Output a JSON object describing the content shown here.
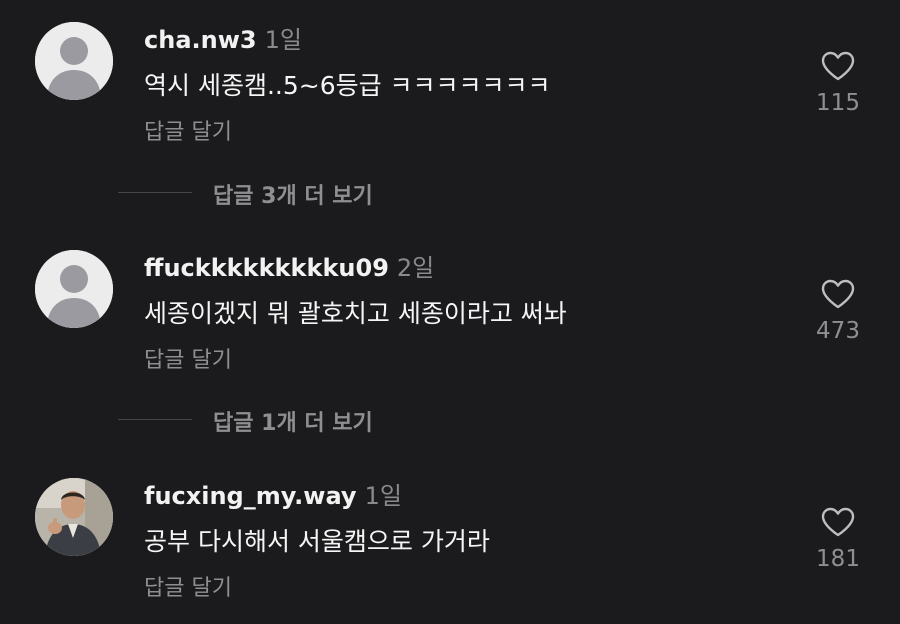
{
  "comments": [
    {
      "username": "cha.nw3",
      "time": "1일",
      "text": "역시 세종캠..5~6등급 ㅋㅋㅋㅋㅋㅋㅋ",
      "reply_label": "답글 달기",
      "likes": "115",
      "avatar": "default-avatar"
    },
    {
      "username": "ffuckkkkkkkkku09",
      "time": "2일",
      "text": "세종이겠지 뭐 괄호치고 세종이라고 써놔",
      "reply_label": "답글 달기",
      "likes": "473",
      "avatar": "default-avatar"
    },
    {
      "username": "fucxing_my.way",
      "time": "1일",
      "text": "공부 다시해서 서울캠으로 가거라",
      "reply_label": "답글 달기",
      "likes": "181",
      "avatar": "photo-avatar"
    }
  ],
  "view_replies": [
    {
      "label": "답글 3개 더 보기"
    },
    {
      "label": "답글 1개 더 보기"
    }
  ],
  "colors": {
    "background": "#1b1b1d",
    "primary_text": "#f2f2f2",
    "secondary_text": "#8f8f93",
    "avatar_bg": "#ececec",
    "avatar_silhouette": "#9a9aa0"
  },
  "icons": {
    "like": "heart-outline-icon"
  }
}
